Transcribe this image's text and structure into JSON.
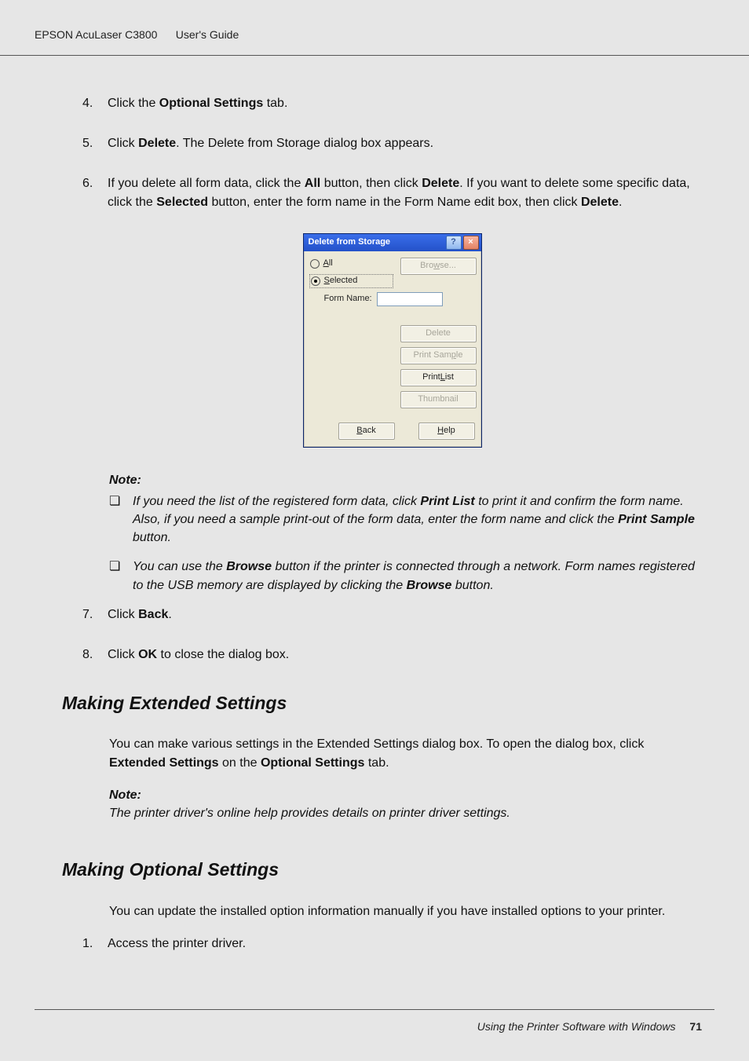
{
  "header": {
    "left": "EPSON AcuLaser C3800",
    "right": "User's Guide"
  },
  "steps": {
    "s4": {
      "num": "4.",
      "pre": "Click the ",
      "b1": "Optional Settings",
      "post": " tab."
    },
    "s5": {
      "num": "5.",
      "pre": "Click ",
      "b1": "Delete",
      "post": ". The Delete from Storage dialog box appears."
    },
    "s6": {
      "num": "6.",
      "t1": "If you delete all form data, click the ",
      "b1": "All",
      "t2": " button, then click ",
      "b2": "Delete",
      "t3": ". If you want to delete some specific data, click the ",
      "b3": "Selected",
      "t4": " button, enter the form name in the Form Name edit box, then click ",
      "b4": "Delete",
      "t5": "."
    },
    "s7": {
      "num": "7.",
      "pre": "Click ",
      "b1": "Back",
      "post": "."
    },
    "s8": {
      "num": "8.",
      "pre": "Click ",
      "b1": "OK",
      "post": " to close the dialog box."
    }
  },
  "dialog": {
    "title": "Delete from Storage",
    "help": "?",
    "close": "×",
    "radio_all_ul": "A",
    "radio_all_rest": "ll",
    "radio_sel_ul": "S",
    "radio_sel_rest": "elected",
    "form_name_label": "Form Name:",
    "btn_browse_pre": "Bro",
    "btn_browse_ul": "w",
    "btn_browse_post": "se...",
    "btn_delete": "Delete",
    "btn_print_sample_pre": "Print Sam",
    "btn_print_sample_ul": "p",
    "btn_print_sample_post": "le",
    "btn_print_list_pre": "Print ",
    "btn_print_list_ul": "L",
    "btn_print_list_post": "ist",
    "btn_thumbnail": "Thumbnail",
    "btn_back_ul": "B",
    "btn_back_rest": "ack",
    "btn_help_ul": "H",
    "btn_help_rest": "elp"
  },
  "note_heading": "Note:",
  "bullet": "❏",
  "notes": {
    "n1": {
      "t1": "If you need the list of the registered form data, click ",
      "b1": "Print List",
      "t2": " to print it and confirm the form name. Also, if you need a sample print-out of the form data, enter the form name and click the ",
      "b2": "Print Sample",
      "t3": " button."
    },
    "n2": {
      "t1": "You can use the ",
      "b1": "Browse",
      "t2": " button if the printer is connected through a network. Form names registered to the USB memory are displayed by clicking the ",
      "b2": "Browse",
      "t3": " button."
    }
  },
  "sections": {
    "ext": {
      "heading": "Making Extended Settings",
      "p_pre": "You can make various settings in the Extended Settings dialog box. To open the dialog box, click ",
      "p_b1": "Extended Settings",
      "p_mid": " on the ",
      "p_b2": "Optional Settings",
      "p_post": " tab.",
      "note": "The printer driver's online help provides details on printer driver settings."
    },
    "opt": {
      "heading": "Making Optional Settings",
      "p": "You can update the installed option information manually if you have installed options to your printer.",
      "s1_num": "1.",
      "s1_text": "Access the printer driver."
    }
  },
  "footer": {
    "text": "Using the Printer Software with Windows",
    "page": "71"
  }
}
